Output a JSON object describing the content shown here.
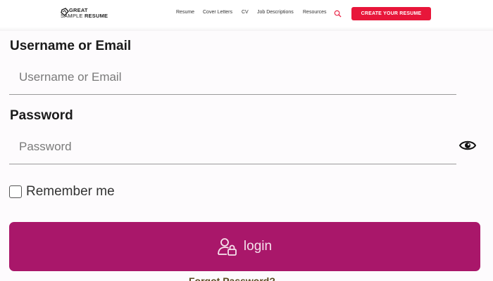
{
  "header": {
    "logo": {
      "line1": "GREAT",
      "line2_a": "SAMPLE",
      "line2_b": "RESUME"
    },
    "nav": [
      "Resume",
      "Cover Letters",
      "CV",
      "Job Descriptions",
      "Resources"
    ],
    "search_icon": "search-icon",
    "cta_label": "CREATE YOUR RESUME",
    "cta_color": "#e8163a"
  },
  "form": {
    "username_label": "Username or Email",
    "username_placeholder": "Username or Email",
    "username_value": "",
    "password_label": "Password",
    "password_placeholder": "Password",
    "password_value": "",
    "password_toggle_icon": "eye-icon",
    "remember_label": "Remember me",
    "remember_checked": false,
    "login_label": "login",
    "login_icon": "user-lock-icon",
    "login_color": "#a9176a",
    "cutoff_text": "Forgot Password?"
  }
}
